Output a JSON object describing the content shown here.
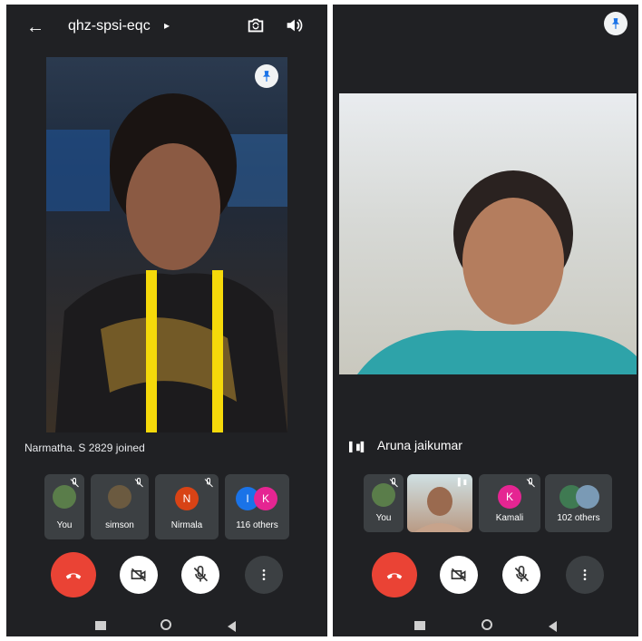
{
  "left": {
    "meeting_code": "qhz-spsi-eqc",
    "toast": "Narmatha. S 2829 joined",
    "participants": [
      {
        "label": "You"
      },
      {
        "label": "simson"
      },
      {
        "label": "Nirmala",
        "initial": "N",
        "color": "#d84315"
      },
      {
        "label": "116 others",
        "initials": [
          "I",
          "K"
        ],
        "colors": [
          "#1a73e8",
          "#e52592"
        ]
      }
    ]
  },
  "right": {
    "speaker_name": "Aruna jaikumar",
    "participants": [
      {
        "label": "You"
      },
      {
        "label": ""
      },
      {
        "label": "Kamali",
        "initial": "K",
        "color": "#e52592"
      },
      {
        "label": "102 others"
      }
    ]
  },
  "icons": {
    "back": "arrow-left-icon",
    "dropdown": "caret-right-icon",
    "switch_camera": "switch-camera-icon",
    "speaker": "speaker-icon",
    "pin": "pin-icon",
    "end_call": "end-call-icon",
    "camera_off": "camera-off-icon",
    "mic_off": "mic-off-icon",
    "more": "more-vert-icon",
    "nav_recent": "square-icon",
    "nav_home": "circle-icon",
    "nav_back": "triangle-icon"
  },
  "colors": {
    "background": "#202124",
    "end_call": "#ea4335",
    "tile": "#3c4043"
  }
}
